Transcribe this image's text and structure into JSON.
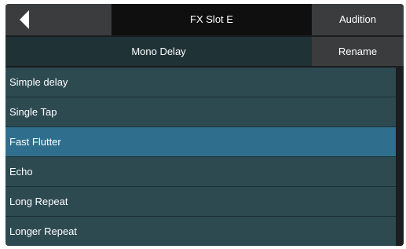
{
  "header": {
    "title": "FX Slot E",
    "audition_label": "Audition",
    "back_icon": "triangle-left"
  },
  "subheader": {
    "preset_type": "Mono Delay",
    "rename_label": "Rename"
  },
  "presets": {
    "items": [
      {
        "label": "Simple delay"
      },
      {
        "label": "Single Tap"
      },
      {
        "label": "Fast Flutter"
      },
      {
        "label": "Echo"
      },
      {
        "label": "Long Repeat"
      },
      {
        "label": "Longer Repeat"
      }
    ],
    "selected_index": 2
  },
  "colors": {
    "accent_selected": "#2f6f8d",
    "list_bg": "#2d4a51",
    "header_bg": "#0f0f10",
    "button_bg": "#3b3c3e"
  }
}
